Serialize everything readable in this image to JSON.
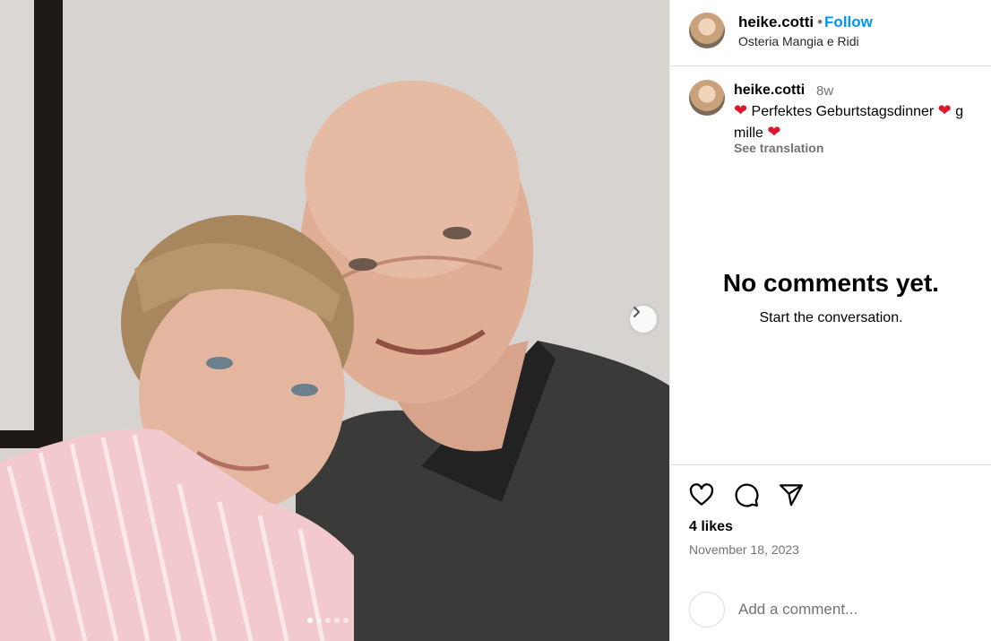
{
  "post": {
    "username": "heike.cotti",
    "follow_label": "Follow",
    "separator": "•",
    "location": "Osteria Mangia e Ridi",
    "carousel": {
      "count": 5,
      "active_index": 0
    }
  },
  "caption": {
    "username": "heike.cotti",
    "time_ago": "8w",
    "text_line1": "Perfektes Geburtstagsdinner",
    "text_line1_tail": "g",
    "text_line2": "mille",
    "heart_glyph": "❤",
    "see_translation": "See translation"
  },
  "comments": {
    "empty_title": "No comments yet.",
    "empty_subtitle": "Start the conversation."
  },
  "actions": {
    "icons": [
      "heart-icon",
      "comment-icon",
      "share-icon"
    ],
    "likes": "4 likes",
    "date": "November 18, 2023"
  },
  "comment_box": {
    "placeholder": "Add a comment..."
  },
  "colors": {
    "follow_blue": "#0095f6",
    "heart_red": "#e0152a",
    "muted_gray": "#737373"
  }
}
